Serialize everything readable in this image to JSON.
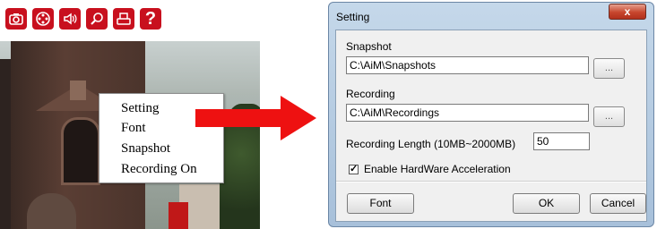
{
  "toolbar": {
    "buttons": [
      {
        "name": "camera-icon"
      },
      {
        "name": "record-reel-icon"
      },
      {
        "name": "speaker-icon"
      },
      {
        "name": "zoom-icon"
      },
      {
        "name": "printer-icon"
      },
      {
        "name": "help-icon",
        "label": "?"
      }
    ]
  },
  "context_menu": {
    "items": [
      "Setting",
      "Font",
      "Snapshot",
      "Recording On"
    ]
  },
  "dialog": {
    "title": "Setting",
    "close_label": "x",
    "snapshot_label": "Snapshot",
    "snapshot_path": "C:\\AiM\\Snapshots",
    "browse_label": "...",
    "recording_label": "Recording",
    "recording_path": "C:\\AiM\\Recordings",
    "recording_length_label": "Recording Length (10MB~2000MB)",
    "recording_length_value": "50",
    "hw_accel_label": "Enable HardWare Acceleration",
    "hw_accel_checked": true,
    "check_mark": "✓",
    "font_button": "Font",
    "ok_button": "OK",
    "cancel_button": "Cancel"
  },
  "colors": {
    "toolbar_red": "#c8101e",
    "arrow_red": "#ee1111",
    "dialog_frame": "#b6cde4"
  }
}
